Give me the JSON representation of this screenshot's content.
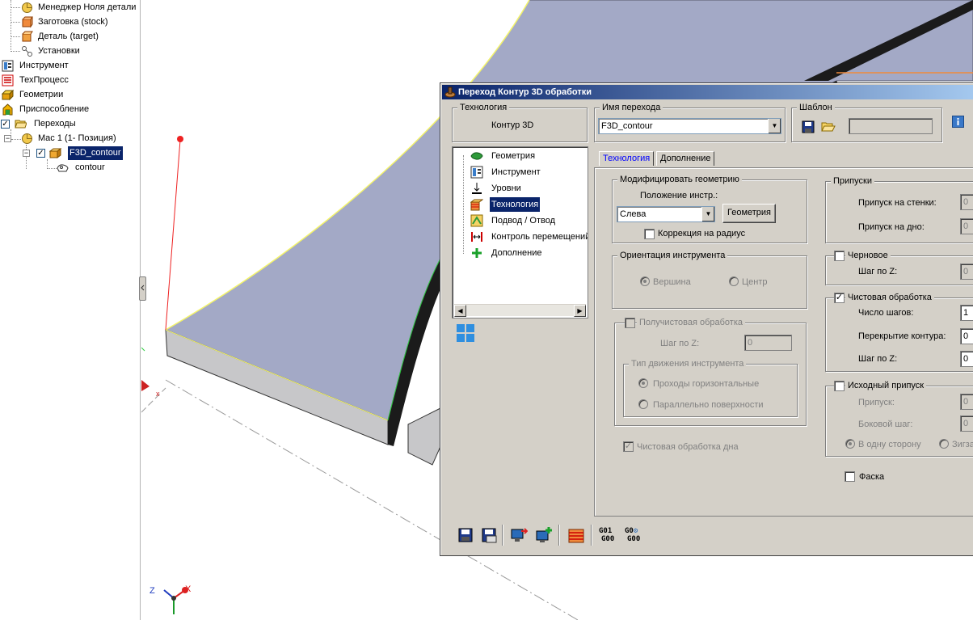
{
  "left_tree": {
    "items": [
      {
        "label": "Менеджер Ноля детали"
      },
      {
        "label": "Заготовка (stock)"
      },
      {
        "label": "Деталь (target)"
      },
      {
        "label": "Установки"
      },
      {
        "label": "Инструмент"
      },
      {
        "label": "ТехПроцесс"
      },
      {
        "label": "Геометрии"
      },
      {
        "label": "Приспособление"
      },
      {
        "label": "Переходы"
      },
      {
        "label": "Mac 1 (1- Позиция)"
      },
      {
        "label": "F3D_contour"
      },
      {
        "label": "contour"
      }
    ]
  },
  "dialog": {
    "title": "Переход Контур 3D обработки",
    "tech_group": {
      "title": "Технология",
      "value": "Контур 3D"
    },
    "name_group": {
      "title": "Имя перехода",
      "value": "F3D_contour"
    },
    "template_group": {
      "title": "Шаблон"
    },
    "nav_items": [
      {
        "label": "Геометрия"
      },
      {
        "label": "Инструмент"
      },
      {
        "label": "Уровни"
      },
      {
        "label": "Технология"
      },
      {
        "label": "Подвод / Отвод"
      },
      {
        "label": "Контроль перемещений"
      },
      {
        "label": "Дополнение"
      }
    ],
    "tabs": [
      {
        "label": "Технология"
      },
      {
        "label": "Дополнение"
      }
    ],
    "modify_geometry": {
      "title": "Модифицировать геометрию",
      "position_label": "Положение инстр.:",
      "position_value": "Слева",
      "geometry_button": "Геометрия",
      "radius_correction": "Коррекция на радиус"
    },
    "tool_orientation": {
      "title": "Ориентация инструмента",
      "option_tip": "Вершина",
      "option_center": "Центр"
    },
    "semi_finish": {
      "title": "Получистовая обработка",
      "step_z_label": "Шаг по Z:",
      "step_z_value": "0",
      "motion_type_title": "Тип движения инструмента",
      "motion_horizontal": "Проходы горизонтальные",
      "motion_parallel": "Параллельно поверхности"
    },
    "finish_bottom": "Чистовая обработка дна",
    "allowances": {
      "title": "Припуски",
      "wall_label": "Припуск на стенки:",
      "wall_value": "0",
      "bottom_label": "Припуск на дно:",
      "bottom_value": "0"
    },
    "rough": {
      "title": "Черновое",
      "step_z_label": "Шаг по Z:",
      "step_z_value": "0"
    },
    "finish": {
      "title": "Чистовая обработка",
      "steps_label": "Число шагов:",
      "steps_value": "1",
      "overlap_label": "Перекрытие контура:",
      "overlap_value": "0",
      "step_z_label": "Шаг по Z:",
      "step_z_value": "0"
    },
    "initial_allowance": {
      "title": "Исходный припуск",
      "allowance_label": "Припуск:",
      "allowance_value": "0",
      "side_step_label": "Боковой шаг:",
      "side_step_value": "0",
      "one_direction": "В одну сторону",
      "zigzag": "Зигза"
    },
    "chamfer": "Фаска",
    "toolbar_codes": {
      "g1": "G01",
      "g2": "G00",
      "g3": "G0",
      "g4": "G00"
    }
  },
  "axes": {
    "z": "Z",
    "x": "X"
  },
  "colors": {
    "title_start": "#0a246a",
    "title_end": "#a6caf0",
    "dialog_bg": "#d4d0c8",
    "part_face": "#a3a9c6"
  }
}
